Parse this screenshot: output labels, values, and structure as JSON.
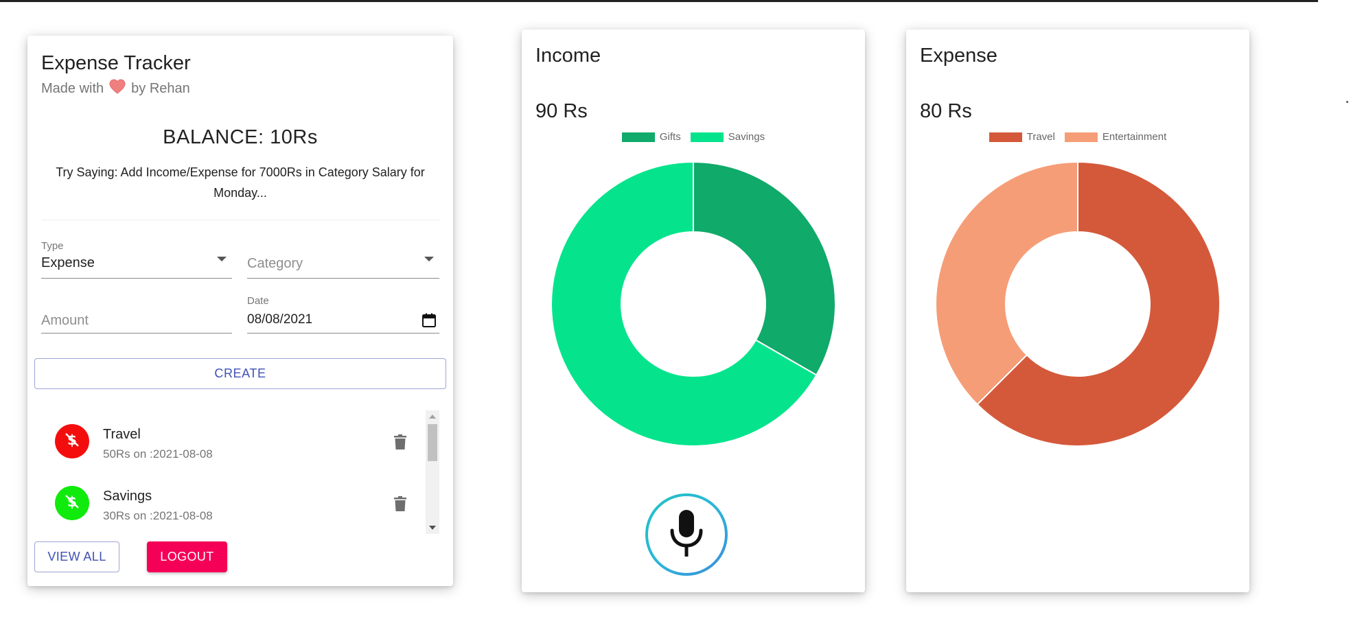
{
  "app": {
    "title": "Expense Tracker",
    "subtitle_prefix": "Made with",
    "subtitle_suffix": "by Rehan",
    "heart_icon": "heart-icon"
  },
  "balance": {
    "text": "BALANCE: 10Rs"
  },
  "hint": {
    "text": "Try Saying: Add Income/Expense for 7000Rs in Category Salary for Monday..."
  },
  "form": {
    "type": {
      "label": "Type",
      "value": "Expense"
    },
    "category": {
      "placeholder": "Category"
    },
    "amount": {
      "placeholder": "Amount"
    },
    "date": {
      "label": "Date",
      "value": "08/08/2021"
    },
    "create_label": "CREATE"
  },
  "transactions": [
    {
      "name": "Travel",
      "detail": "50Rs on :2021-08-08",
      "color": "#f40d0d",
      "icon": "dollar-off-icon"
    },
    {
      "name": "Savings",
      "detail": "30Rs on :2021-08-08",
      "color": "#11ea0d",
      "icon": "dollar-off-icon"
    }
  ],
  "buttons": {
    "view_all": "VIEW ALL",
    "logout": "LOGOUT"
  },
  "income": {
    "title": "Income",
    "amount": "90 Rs",
    "chart_data": {
      "type": "pie",
      "title": "",
      "categories": [
        "Gifts",
        "Savings"
      ],
      "values": [
        30,
        60
      ],
      "colors": [
        "#10aa6a",
        "#05e48c"
      ],
      "legend_position": "top"
    }
  },
  "expense": {
    "title": "Expense",
    "amount": "80 Rs",
    "chart_data": {
      "type": "pie",
      "title": "",
      "categories": [
        "Travel",
        "Entertainment"
      ],
      "values": [
        50,
        30
      ],
      "colors": [
        "#d4593a",
        "#f59d77"
      ],
      "legend_position": "top"
    }
  },
  "mic": {
    "icon": "microphone-icon"
  }
}
